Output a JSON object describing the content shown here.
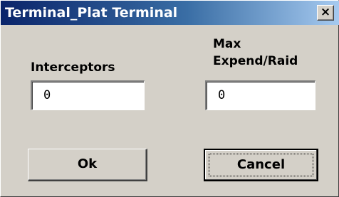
{
  "window": {
    "title": "Terminal_Plat Terminal",
    "close_glyph": "×"
  },
  "form": {
    "interceptors_label": "Interceptors",
    "interceptors_value": "0",
    "max_expend_label_line1": "Max",
    "max_expend_label_line2": "Expend/Raid",
    "max_expend_value": "0"
  },
  "buttons": {
    "ok_label": "Ok",
    "cancel_label": "Cancel"
  }
}
